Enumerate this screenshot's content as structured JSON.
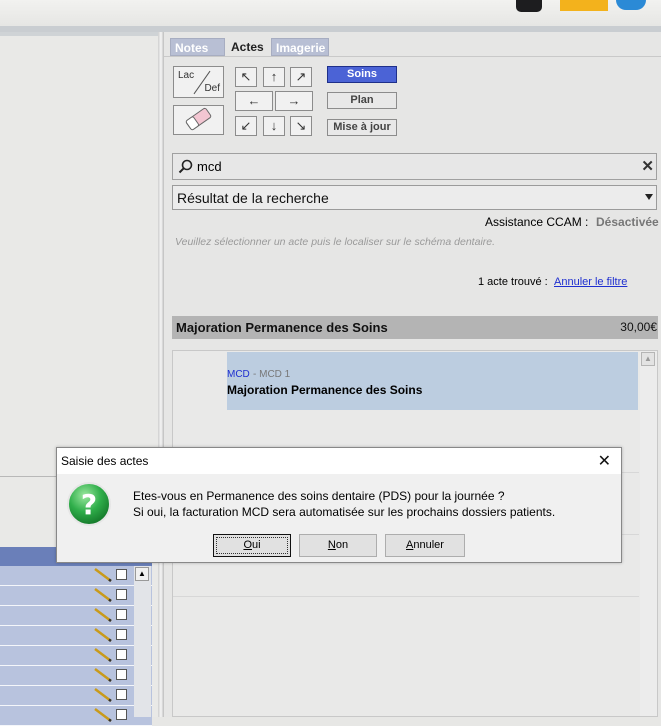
{
  "tabs": {
    "notes": "Notes",
    "actes": "Actes",
    "imagerie": "Imagerie"
  },
  "toolbar": {
    "lac_label": "Lac",
    "def_label": "Def",
    "soins_label": "Soins",
    "plan_label": "Plan",
    "mise_a_jour_label": "Mise à jour",
    "arrows": [
      "↖",
      "↑",
      "↗",
      "←",
      "→",
      "↙",
      "↓",
      "↘"
    ]
  },
  "search": {
    "value": "mcd",
    "clear_symbol": "✕"
  },
  "result_select": {
    "selected": "Résultat de la recherche"
  },
  "ccam": {
    "label": "Assistance CCAM :",
    "value": "Désactivée"
  },
  "hint": "Veuillez sélectionner un acte puis le localiser sur le schéma dentaire.",
  "filter": {
    "found_text": "1 acte trouvé :",
    "reset_link": "Annuler le filtre"
  },
  "selected_act": {
    "title": "Majoration Permanence des Soins",
    "price": "30,00€"
  },
  "result_item": {
    "code": "MCD",
    "subcode": "- MCD 1",
    "title": "Majoration Permanence des Soins"
  },
  "dialog": {
    "title": "Saisie des actes",
    "line1": "Etes-vous en Permanence des soins dentaire (PDS) pour la journée ?",
    "line2": "Si oui, la facturation MCD sera automatisée sur les prochains dossiers patients.",
    "oui_first": "O",
    "oui_rest": "ui",
    "non_first": "N",
    "non_rest": "on",
    "annuler_first": "A",
    "annuler_rest": "nnuler"
  },
  "colors": {
    "accent_blue": "#4b63d6",
    "list_blue": "#b8c3de",
    "result_highlight": "#bccde0",
    "dialog_icon": "#2aa84a"
  }
}
